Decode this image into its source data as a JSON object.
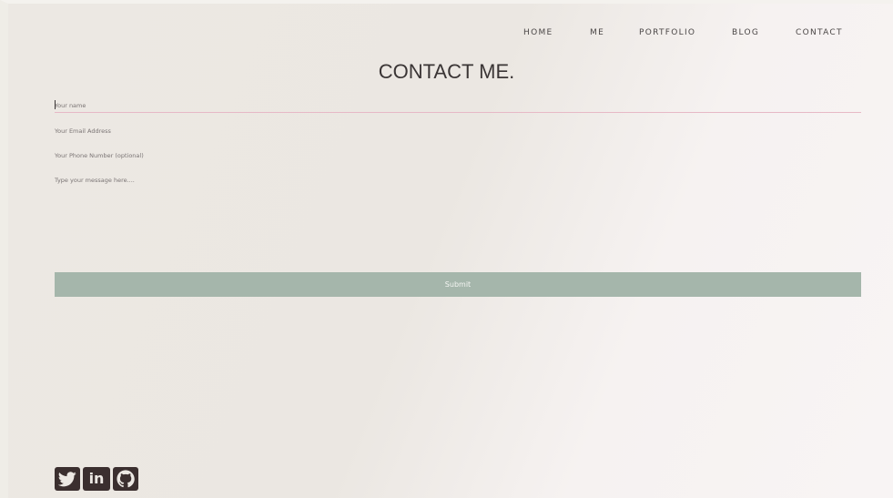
{
  "nav": {
    "items": [
      {
        "label": "HOME"
      },
      {
        "label": "ME"
      },
      {
        "label": "PORTFOLIO"
      },
      {
        "label": "BLOG"
      },
      {
        "label": "CONTACT"
      }
    ]
  },
  "page_title": "CONTACT ME.",
  "form": {
    "name_placeholder": "Your name",
    "email_placeholder": "Your Email Address",
    "phone_placeholder": "Your Phone Number (optional)",
    "message_placeholder": "Type your message here....",
    "submit_label": "Submit"
  },
  "socials": [
    {
      "icon": "twitter-icon"
    },
    {
      "icon": "linkedin-icon"
    },
    {
      "icon": "github-icon"
    }
  ],
  "colors": {
    "background": "#ece8e3",
    "submit_button": "#a5b6ab",
    "active_field_underline": "#e7b9c6",
    "icon": "#3b2f2f",
    "text": "#3a3535"
  }
}
